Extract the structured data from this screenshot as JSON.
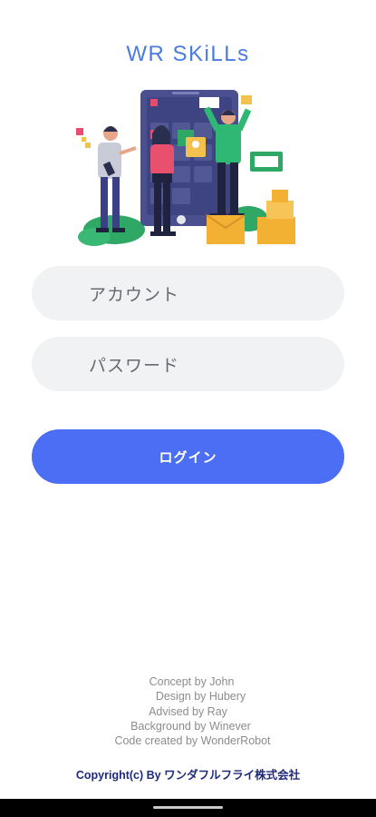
{
  "app": {
    "logo_text": "WR SKiLLs"
  },
  "form": {
    "account_placeholder": "アカウント",
    "password_placeholder": "パスワード",
    "login_label": "ログイン"
  },
  "credits": {
    "lines": [
      "Concept by John",
      "Design by Hubery",
      "Advised by Ray",
      "Background by Winever",
      "Code created by WonderRobot"
    ],
    "copyright": "Copyright(c) By ワンダフルフライ株式会社"
  },
  "colors": {
    "brand_blue": "#4a7be0",
    "button_blue": "#4b6ef5",
    "field_bg": "#f1f2f4",
    "credits_gray": "#8c8c8c",
    "copyright_navy": "#1f2a7a"
  },
  "icons": {
    "hero": "team-collaboration-illustration"
  }
}
